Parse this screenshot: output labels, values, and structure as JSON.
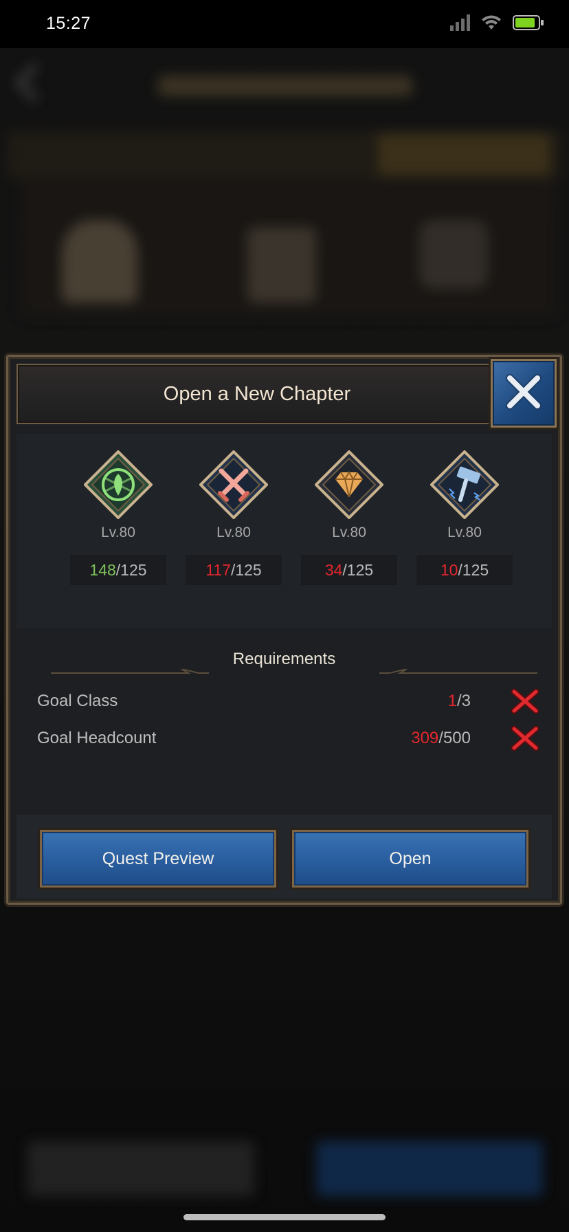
{
  "status_bar": {
    "time": "15:27"
  },
  "dialog": {
    "title": "Open a New Chapter",
    "classes": [
      {
        "icon": "leaf-emblem-icon",
        "level": "Lv.80",
        "current": "148",
        "total": "/125",
        "status": "met"
      },
      {
        "icon": "crossed-swords-icon",
        "level": "Lv.80",
        "current": "117",
        "total": "/125",
        "status": "unmet"
      },
      {
        "icon": "diamond-icon",
        "level": "Lv.80",
        "current": "34",
        "total": "/125",
        "status": "unmet"
      },
      {
        "icon": "hammer-icon",
        "level": "Lv.80",
        "current": "10",
        "total": "/125",
        "status": "unmet"
      }
    ],
    "requirements": {
      "heading": "Requirements",
      "rows": [
        {
          "label": "Goal Class",
          "current": "1",
          "total": "/3",
          "status": "unmet"
        },
        {
          "label": "Goal Headcount",
          "current": "309",
          "total": "/500",
          "status": "unmet"
        }
      ]
    },
    "buttons": {
      "preview_label": "Quest Preview",
      "open_label": "Open"
    }
  },
  "colors": {
    "met": "#7ec15a",
    "unmet": "#e6262d",
    "button_blue": "#2a5fa0",
    "frame_bronze": "#6b5a44"
  }
}
